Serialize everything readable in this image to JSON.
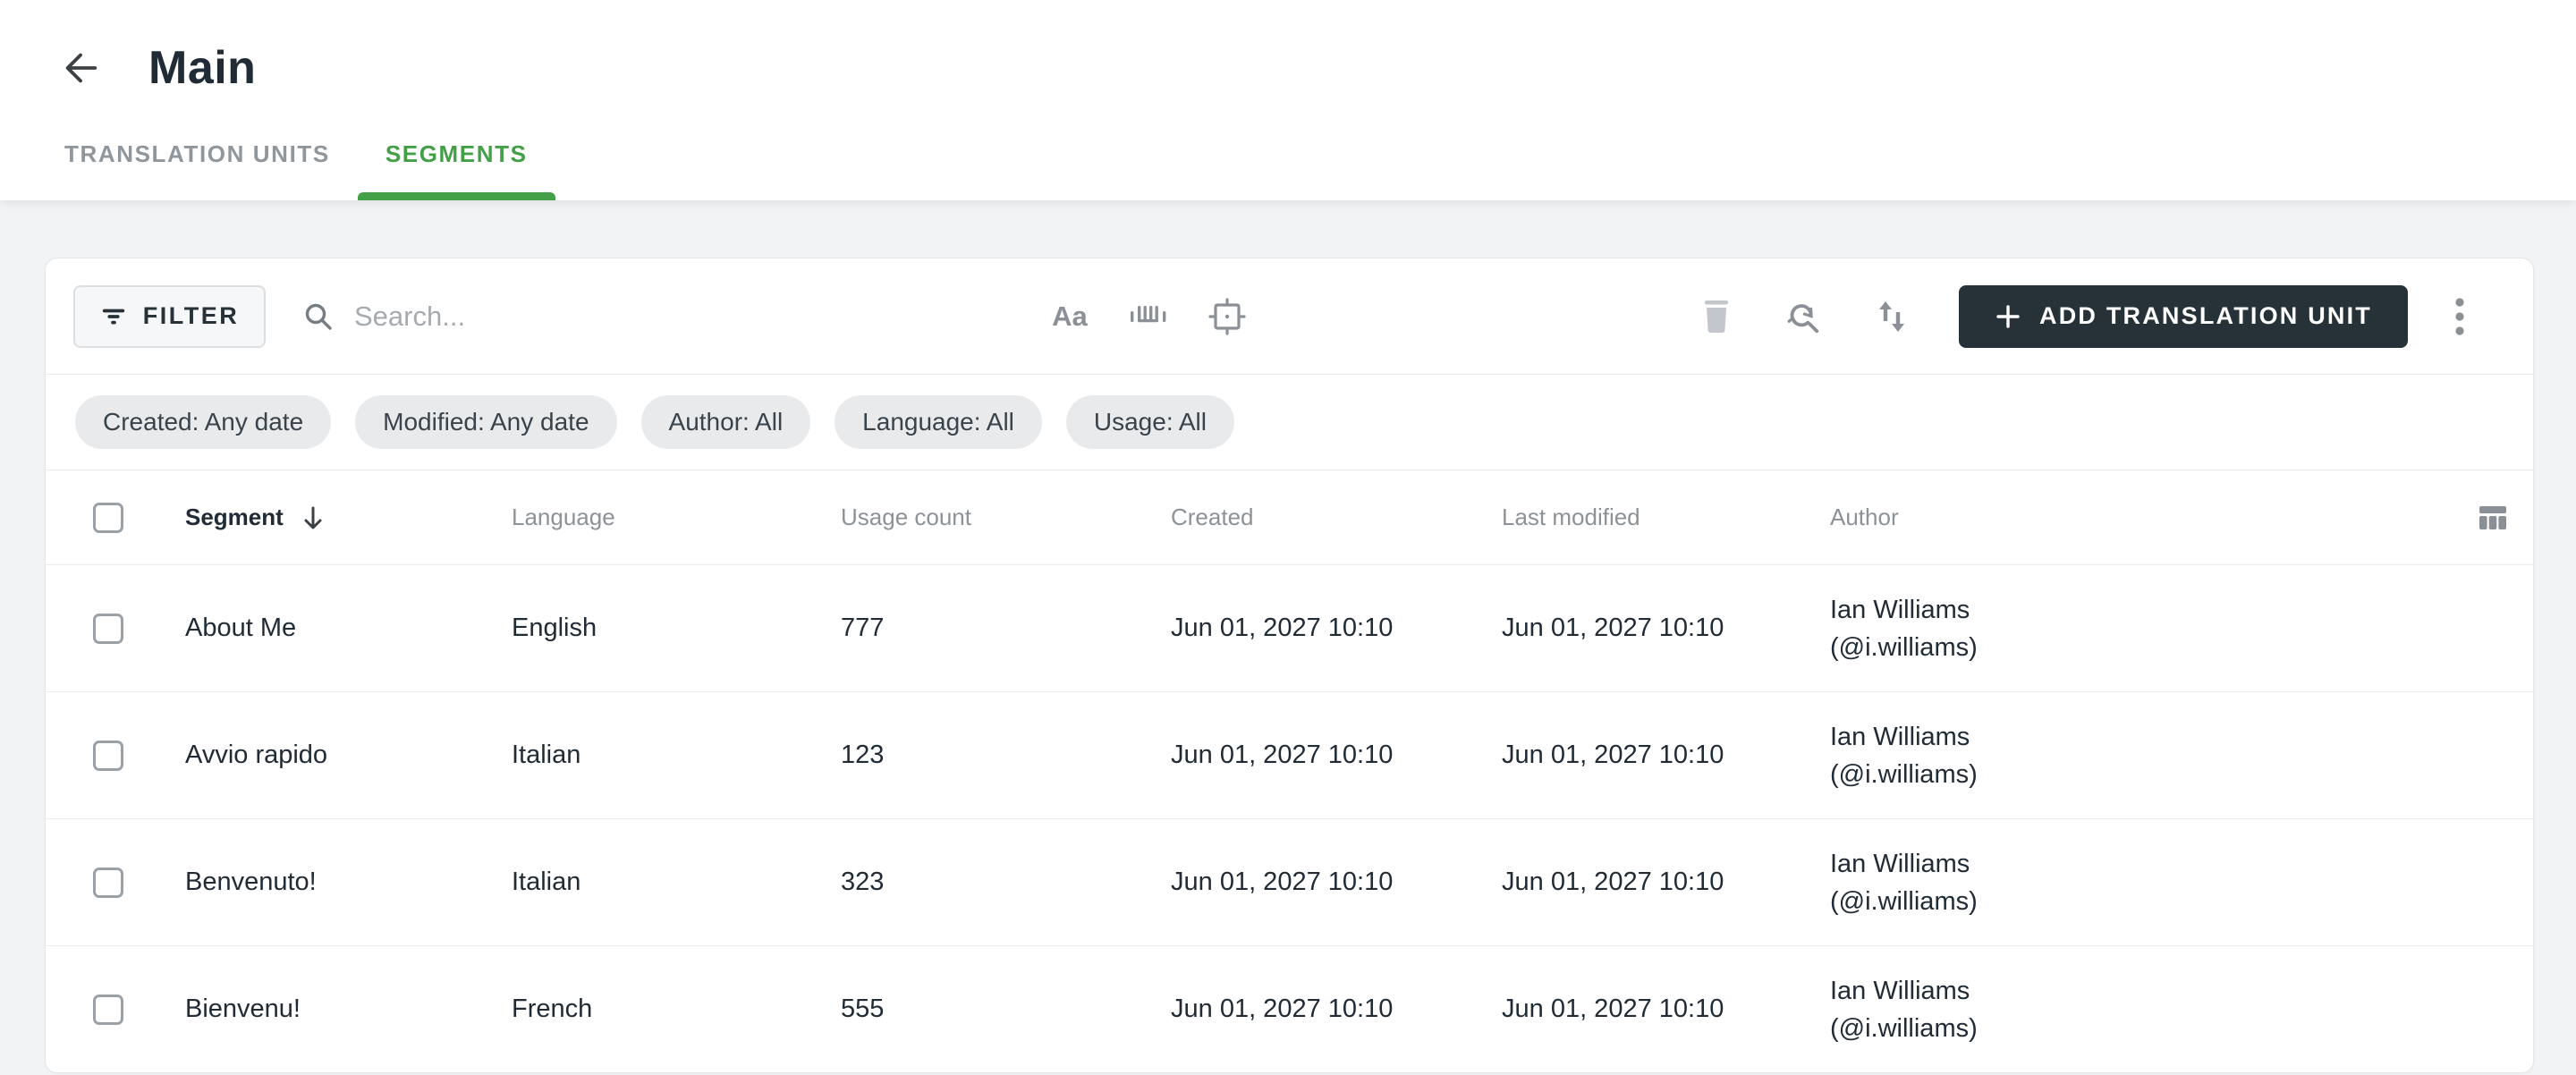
{
  "page": {
    "title": "Main"
  },
  "tabs": [
    {
      "label": "TRANSLATION UNITS",
      "active": false
    },
    {
      "label": "SEGMENTS",
      "active": true
    }
  ],
  "toolbar": {
    "filter_label": "FILTER",
    "search_placeholder": "Search...",
    "match_case_glyph": "Aa",
    "add_button_label": "ADD TRANSLATION UNIT"
  },
  "filter_chips": [
    {
      "label": "Created: Any date"
    },
    {
      "label": "Modified: Any date"
    },
    {
      "label": "Author: All"
    },
    {
      "label": "Language: All"
    },
    {
      "label": "Usage: All"
    }
  ],
  "table": {
    "headers": {
      "segment": "Segment",
      "language": "Language",
      "usage_count": "Usage count",
      "created": "Created",
      "last_modified": "Last modified",
      "author": "Author"
    },
    "sorted_column": "Segment",
    "sort_direction": "descending",
    "rows": [
      {
        "segment": "About Me",
        "language": "English",
        "usage_count": "777",
        "created": "Jun 01, 2027 10:10",
        "last_modified": "Jun 01, 2027 10:10",
        "author_name": "Ian Williams",
        "author_handle": "(@i.williams)"
      },
      {
        "segment": "Avvio rapido",
        "language": "Italian",
        "usage_count": "123",
        "created": "Jun 01, 2027 10:10",
        "last_modified": "Jun 01, 2027 10:10",
        "author_name": "Ian Williams",
        "author_handle": "(@i.williams)"
      },
      {
        "segment": "Benvenuto!",
        "language": "Italian",
        "usage_count": "323",
        "created": "Jun 01, 2027 10:10",
        "last_modified": "Jun 01, 2027 10:10",
        "author_name": "Ian Williams",
        "author_handle": "(@i.williams)"
      },
      {
        "segment": "Bienvenu!",
        "language": "French",
        "usage_count": "555",
        "created": "Jun 01, 2027 10:10",
        "last_modified": "Jun 01, 2027 10:10",
        "author_name": "Ian Williams",
        "author_handle": "(@i.williams)"
      }
    ]
  },
  "colors": {
    "accent_green": "#43a047",
    "button_dark": "#263238"
  }
}
